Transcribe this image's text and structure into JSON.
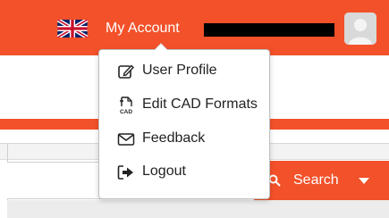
{
  "header": {
    "flag_icon": "uk-flag-icon",
    "account_label": "My Account",
    "avatar_icon": "user-avatar-icon"
  },
  "account_menu": {
    "items": [
      {
        "label": "User Profile",
        "icon": "edit-profile-icon"
      },
      {
        "label": "Edit CAD Formats",
        "icon": "cad-file-icon"
      },
      {
        "label": "Feedback",
        "icon": "envelope-icon"
      },
      {
        "label": "Logout",
        "icon": "sign-out-icon"
      }
    ]
  },
  "search": {
    "button_label": "Search",
    "icon": "search-icon",
    "dropdown_icon": "caret-down-icon"
  },
  "colors": {
    "brand": "#f2512a",
    "menu_text": "#222222",
    "border": "#bfbfbf"
  }
}
